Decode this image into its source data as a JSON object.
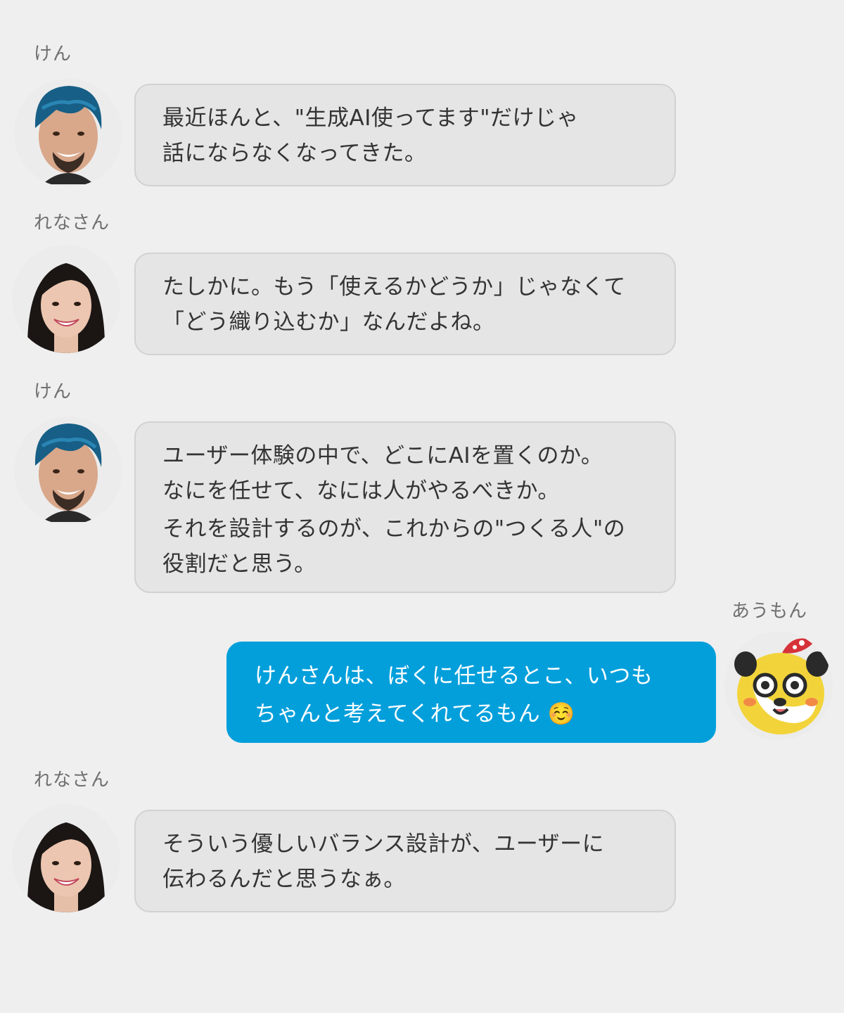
{
  "messages": [
    {
      "sender": "けん",
      "avatar_icon": "ken-avatar-icon",
      "side": "left",
      "lines": [
        "最近ほんと、\"生成AI使ってます\"だけじゃ",
        "話にならなくなってきた。"
      ]
    },
    {
      "sender": "れなさん",
      "avatar_icon": "rena-avatar-icon",
      "side": "left",
      "lines": [
        "たしかに。もう「使えるかどうか」じゃなくて",
        "「どう織り込むか」なんだよね。"
      ]
    },
    {
      "sender": "けん",
      "avatar_icon": "ken-avatar-icon",
      "side": "left",
      "lines": [
        "ユーザー体験の中で、どこにAIを置くのか。",
        "なにを任せて、なには人がやるべきか。",
        "それを設計するのが、これからの\"つくる人\"の",
        "役割だと思う。"
      ]
    },
    {
      "sender": "あうもん",
      "avatar_icon": "aumon-mascot-avatar-icon",
      "side": "right",
      "lines": [
        "けんさんは、ぼくに任せるとこ、いつも",
        "ちゃんと考えてくれてるもん ☺️"
      ]
    },
    {
      "sender": "れなさん",
      "avatar_icon": "rena-avatar-icon",
      "side": "left",
      "lines": [
        "そういう優しいバランス設計が、ユーザーに",
        "伝わるんだと思うなぁ。"
      ]
    }
  ],
  "colors": {
    "background": "#efefef",
    "bubble_left": "#e5e5e5",
    "bubble_right": "#029fdb",
    "text_dark": "#333333",
    "text_light": "#ffffff",
    "name_text": "#6f6f6f"
  }
}
